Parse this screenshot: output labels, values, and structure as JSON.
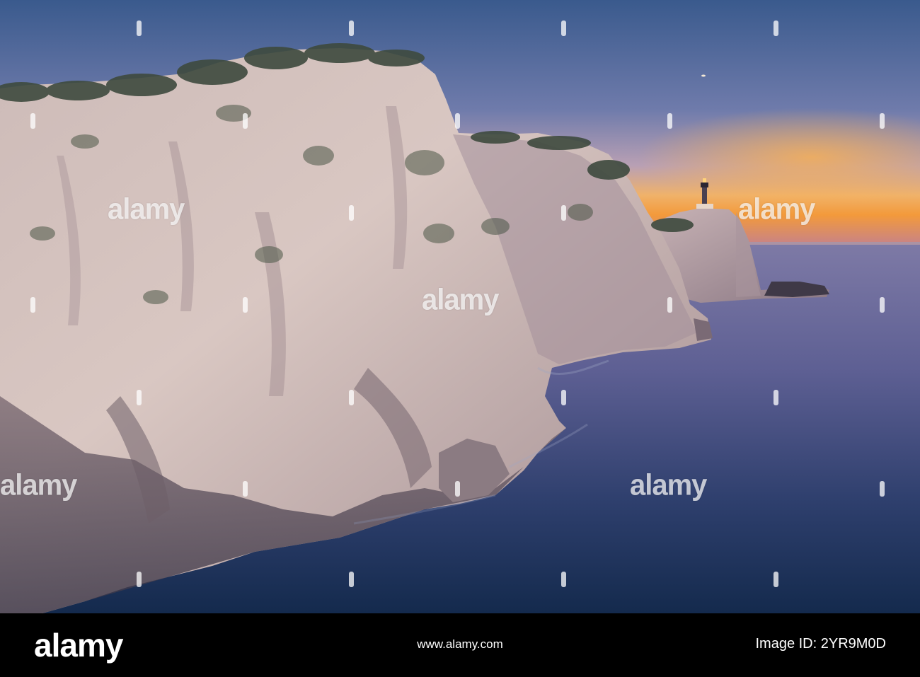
{
  "image": {
    "description_colors": {
      "sky_top": "#3d5a87",
      "sky_mid": "#8a7fae",
      "horizon_glow": "#f4a43a",
      "sea_deep": "#172a4f",
      "sea_light": "#6d6c9e",
      "cliff_light": "#d8c6c2",
      "cliff_shadow": "#7c6e77"
    }
  },
  "watermark": {
    "word": "alamy"
  },
  "footer": {
    "brand": "alamy",
    "image_id": "Image ID: 2YR9M0D",
    "site": "www.alamy.com"
  }
}
